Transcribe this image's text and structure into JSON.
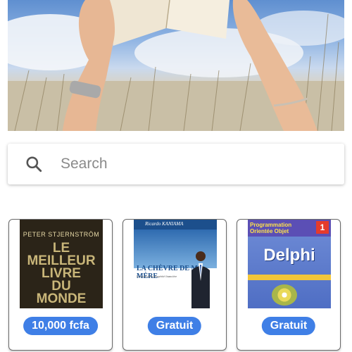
{
  "search": {
    "placeholder": "Search"
  },
  "books": [
    {
      "cover": {
        "author": "PETER STJERNSTRÖM",
        "title_lines": [
          "LE",
          "MEILLEUR",
          "LIVRE",
          "DU",
          "MONDE"
        ]
      },
      "price": "10,000 fcfa"
    },
    {
      "cover": {
        "author": "Ricardo KANIAMA",
        "title": "LA CHÈVRE DE MA MÈRE",
        "subtitle": "Le secret de la prospérité financière"
      },
      "price": "Gratuit"
    },
    {
      "cover": {
        "top_line1": "Programmation",
        "top_line2": "Orientée Objet",
        "volume": "1",
        "title": "Delphi"
      },
      "price": "Gratuit"
    }
  ]
}
